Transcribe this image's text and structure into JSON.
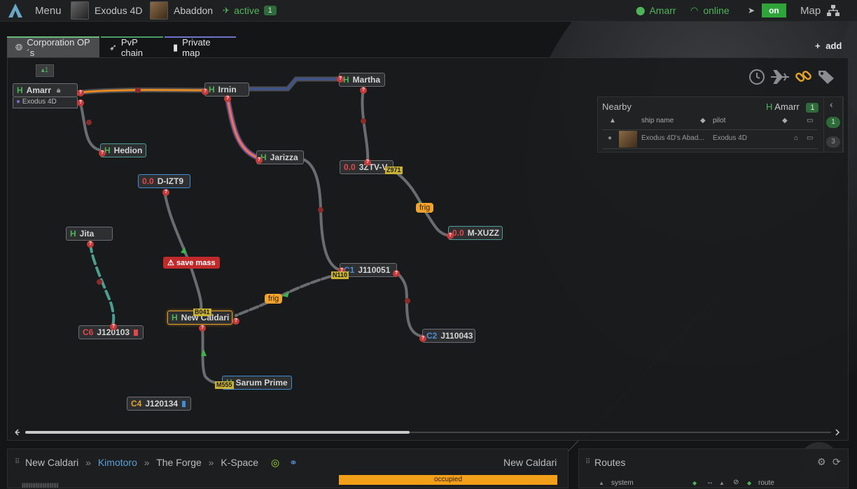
{
  "topbar": {
    "menu_label": "Menu",
    "character": "Exodus 4D",
    "ship": "Abaddon",
    "active_label": "active",
    "active_count": "1",
    "location": "Amarr",
    "online_label": "online",
    "toggle_label": "on",
    "map_label": "Map"
  },
  "tabs": [
    {
      "label": "Corporation OP´s",
      "color": "#6ab87a"
    },
    {
      "label": "PvP chain",
      "color": "#4c9a66"
    },
    {
      "label": "Private map",
      "color": "#6d73c8"
    }
  ],
  "add_label": "add",
  "map": {
    "user_count": "1",
    "amarr_pilot": "Exodus 4D",
    "systems": {
      "amarr": {
        "sec": "H",
        "name": "Amarr"
      },
      "irnin": {
        "sec": "H",
        "name": "Irnin"
      },
      "martha": {
        "sec": "H",
        "name": "Martha"
      },
      "hedion": {
        "sec": "H",
        "name": "Hedion"
      },
      "jarizza": {
        "sec": "H",
        "name": "Jarizza"
      },
      "z3": {
        "sec": "0.0",
        "name": "3ZTV-V"
      },
      "dizt9": {
        "sec": "0.0",
        "name": "D-IZT9"
      },
      "mxuzz": {
        "sec": "0.0",
        "name": "M-XUZZ"
      },
      "jita": {
        "sec": "H",
        "name": "Jita"
      },
      "j110051": {
        "sec": "C1",
        "name": "J110051"
      },
      "newcaldari": {
        "sec": "H",
        "name": "New Caldari"
      },
      "j120103": {
        "sec": "C6",
        "name": "J120103"
      },
      "j110043": {
        "sec": "C2",
        "name": "J110043"
      },
      "sarum": {
        "sec": "H",
        "name": "Sarum Prime"
      },
      "j120134": {
        "sec": "C4",
        "name": "J120134"
      }
    },
    "signatures": {
      "z971": "Z971",
      "n110": "N110",
      "b041": "B041",
      "m555": "M555"
    },
    "frig_label": "frig",
    "save_mass_label": "save mass"
  },
  "nearby": {
    "title": "Nearby",
    "system_sec": "H",
    "system": "Amarr",
    "count": "1",
    "col_ship": "ship name",
    "col_pilot": "pilot",
    "row_ship": "Exodus 4D's Abad...",
    "row_pilot": "Exodus 4D",
    "side_counts": [
      "1",
      "3"
    ]
  },
  "bottom": {
    "breadcrumb": [
      "New Caldari",
      "Kimotoro",
      "The Forge",
      "K-Space"
    ],
    "right_title": "New Caldari",
    "occupied_label": "occupied",
    "routes_title": "Routes",
    "routes_cols": [
      "system",
      "route"
    ],
    "status_text": "IIIIIIIIIIIIIIIIIIIII"
  },
  "colors": {
    "accent_green": "#2fa43a",
    "eol_connection": "#e56a2a",
    "frigate_tag": "#f0a42d",
    "save_mass": "#c02a2a"
  }
}
